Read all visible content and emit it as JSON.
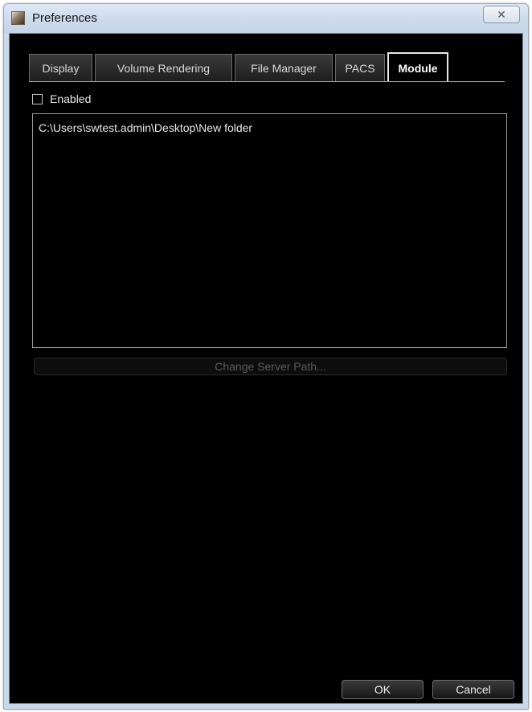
{
  "window": {
    "title": "Preferences",
    "close_glyph": "✕"
  },
  "tabs": [
    {
      "label": "Display"
    },
    {
      "label": "Volume Rendering"
    },
    {
      "label": "File Manager"
    },
    {
      "label": "PACS"
    },
    {
      "label": "Module",
      "active": true
    }
  ],
  "module": {
    "enabled_label": "Enabled",
    "enabled_checked": false,
    "paths": [
      "C:\\Users\\swtest.admin\\Desktop\\New folder"
    ],
    "change_server_path_label": "Change Server Path..."
  },
  "footer": {
    "ok_label": "OK",
    "cancel_label": "Cancel"
  }
}
